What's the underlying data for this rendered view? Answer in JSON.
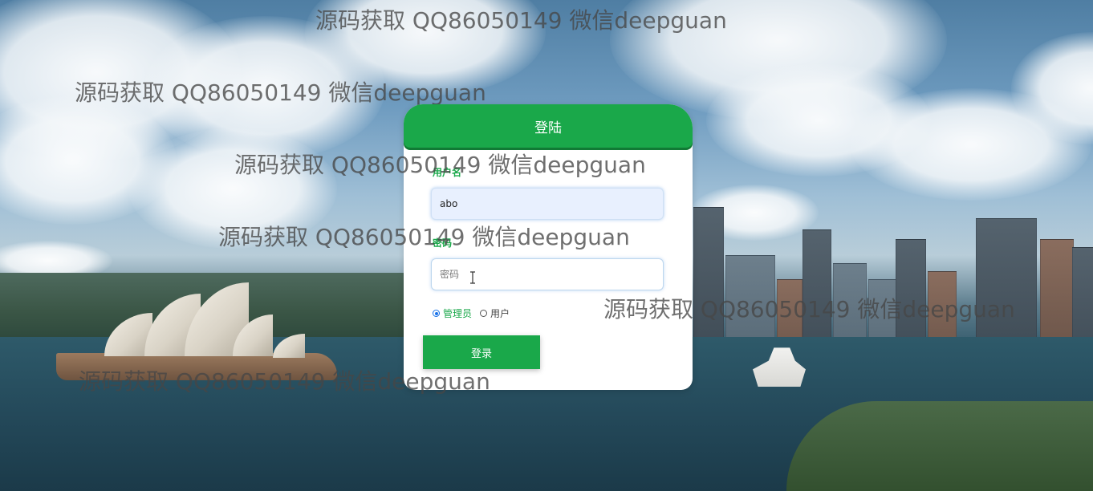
{
  "background": {
    "description_icon": "harbour-city-photo"
  },
  "watermarks": [
    "源码获取 QQ86050149 微信deepguan",
    "源码获取 QQ86050149 微信deepguan",
    "源码获取 QQ86050149 微信deepguan",
    "源码获取 QQ86050149 微信deepguan",
    "源码获取 QQ86050149 微信deepguan",
    "源码获取 QQ86050149 微信deepguan"
  ],
  "login": {
    "title": "登陆",
    "username_label": "用户名",
    "username_value": "abo",
    "password_label": "密码",
    "password_placeholder": "密码",
    "roles": {
      "admin_label": "管理员",
      "user_label": "用户",
      "selected": "管理员"
    },
    "submit_label": "登录",
    "accent_color": "#1aa84a"
  }
}
